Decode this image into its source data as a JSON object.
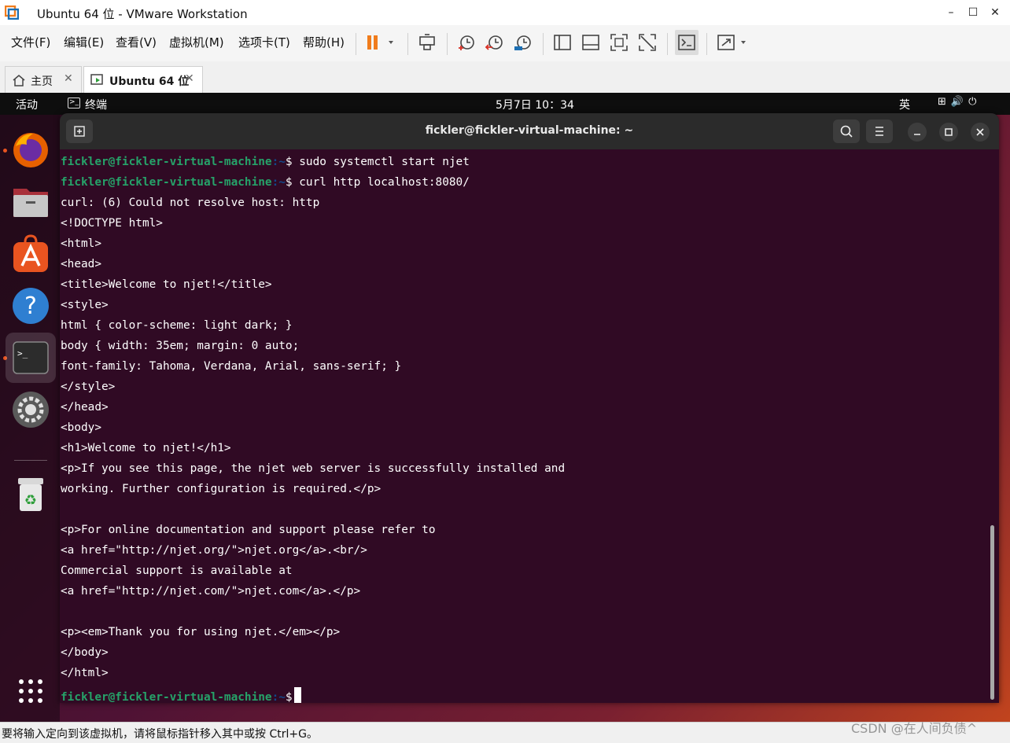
{
  "window": {
    "title": "Ubuntu 64 位 - VMware Workstation",
    "minimize": "–",
    "maximize": "☐",
    "close": "✕"
  },
  "menu": {
    "file": "文件(F)",
    "edit": "编辑(E)",
    "view": "查看(V)",
    "vm": "虚拟机(M)",
    "tabs": "选项卡(T)",
    "help": "帮助(H)"
  },
  "tabs": [
    {
      "label": "主页",
      "close": "✕"
    },
    {
      "label": "Ubuntu 64 位",
      "close": "✕"
    }
  ],
  "guest_top": {
    "activities": "活动",
    "app": "终端",
    "clock": "5月7日  10：34",
    "ime": "英",
    "sys_icons": "⊞🔊⏻"
  },
  "terminal": {
    "title": "fickler@fickler-virtual-machine: ~",
    "user_host": "fickler@fickler-virtual-machine",
    "path": ":~",
    "prompt_sym": "$",
    "commands": [
      " sudo systemctl start njet",
      " curl http localhost:8080/"
    ],
    "output": [
      "curl: (6) Could not resolve host: http",
      "<!DOCTYPE html>",
      "<html>",
      "<head>",
      "<title>Welcome to njet!</title>",
      "<style>",
      "html { color-scheme: light dark; }",
      "body { width: 35em; margin: 0 auto;",
      "font-family: Tahoma, Verdana, Arial, sans-serif; }",
      "</style>",
      "</head>",
      "<body>",
      "<h1>Welcome to njet!</h1>",
      "<p>If you see this page, the njet web server is successfully installed and",
      "working. Further configuration is required.</p>",
      "",
      "<p>For online documentation and support please refer to",
      "<a href=\"http://njet.org/\">njet.org</a>.<br/>",
      "Commercial support is available at",
      "<a href=\"http://njet.com/\">njet.com</a>.</p>",
      "",
      "<p><em>Thank you for using njet.</em></p>",
      "</body>",
      "</html>"
    ]
  },
  "status": {
    "message": "要将输入定向到该虚拟机，请将鼠标指针移入其中或按 Ctrl+G。",
    "watermark": "CSDN @在人间负债^"
  },
  "colors": {
    "terminal_bg": "#300a24",
    "prompt_green": "#26a269",
    "prompt_blue": "#12488b",
    "ubuntu_orange": "#e95420",
    "pause_orange": "#f07c1c"
  }
}
